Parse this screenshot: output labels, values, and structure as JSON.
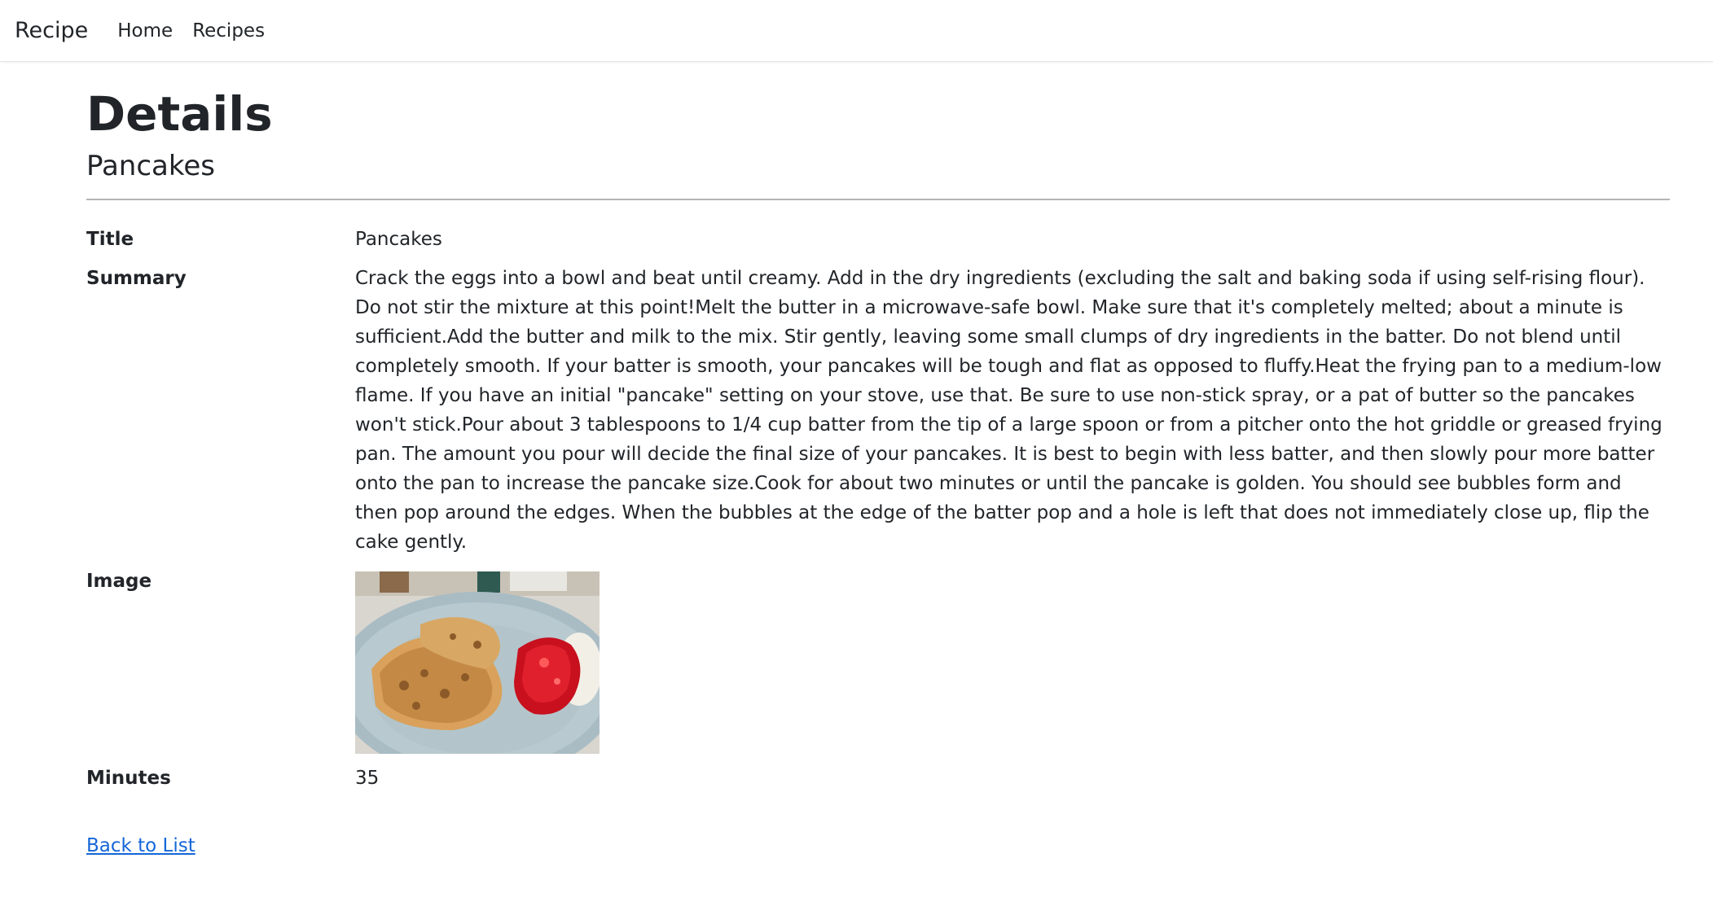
{
  "navbar": {
    "brand": "Recipe",
    "links": [
      "Home",
      "Recipes"
    ]
  },
  "page": {
    "heading": "Details",
    "subheading": "Pancakes"
  },
  "details": {
    "title_label": "Title",
    "title_value": "Pancakes",
    "summary_label": "Summary",
    "summary_value": "Crack the eggs into a bowl and beat until creamy. Add in the dry ingredients (excluding the salt and baking soda if using self-rising flour). Do not stir the mixture at this point!Melt the butter in a microwave-safe bowl. Make sure that it's completely melted; about a minute is sufficient.Add the butter and milk to the mix. Stir gently, leaving some small clumps of dry ingredients in the batter. Do not blend until completely smooth. If your batter is smooth, your pancakes will be tough and flat as opposed to fluffy.Heat the frying pan to a medium-low flame. If you have an initial \"pancake\" setting on your stove, use that. Be sure to use non-stick spray, or a pat of butter so the pancakes won't stick.Pour about 3 tablespoons to 1/4 cup batter from the tip of a large spoon or from a pitcher onto the hot griddle or greased frying pan. The amount you pour will decide the final size of your pancakes. It is best to begin with less batter, and then slowly pour more batter onto the pan to increase the pancake size.Cook for about two minutes or until the pancake is golden. You should see bubbles form and then pop around the edges. When the bubbles at the edge of the batter pop and a hole is left that does not immediately close up, flip the cake gently.",
    "image_label": "Image",
    "minutes_label": "Minutes",
    "minutes_value": "35"
  },
  "back_link": "Back to List",
  "colors": {
    "link": "#1466d8",
    "text": "#212529",
    "divider": "#b5b5b5"
  }
}
